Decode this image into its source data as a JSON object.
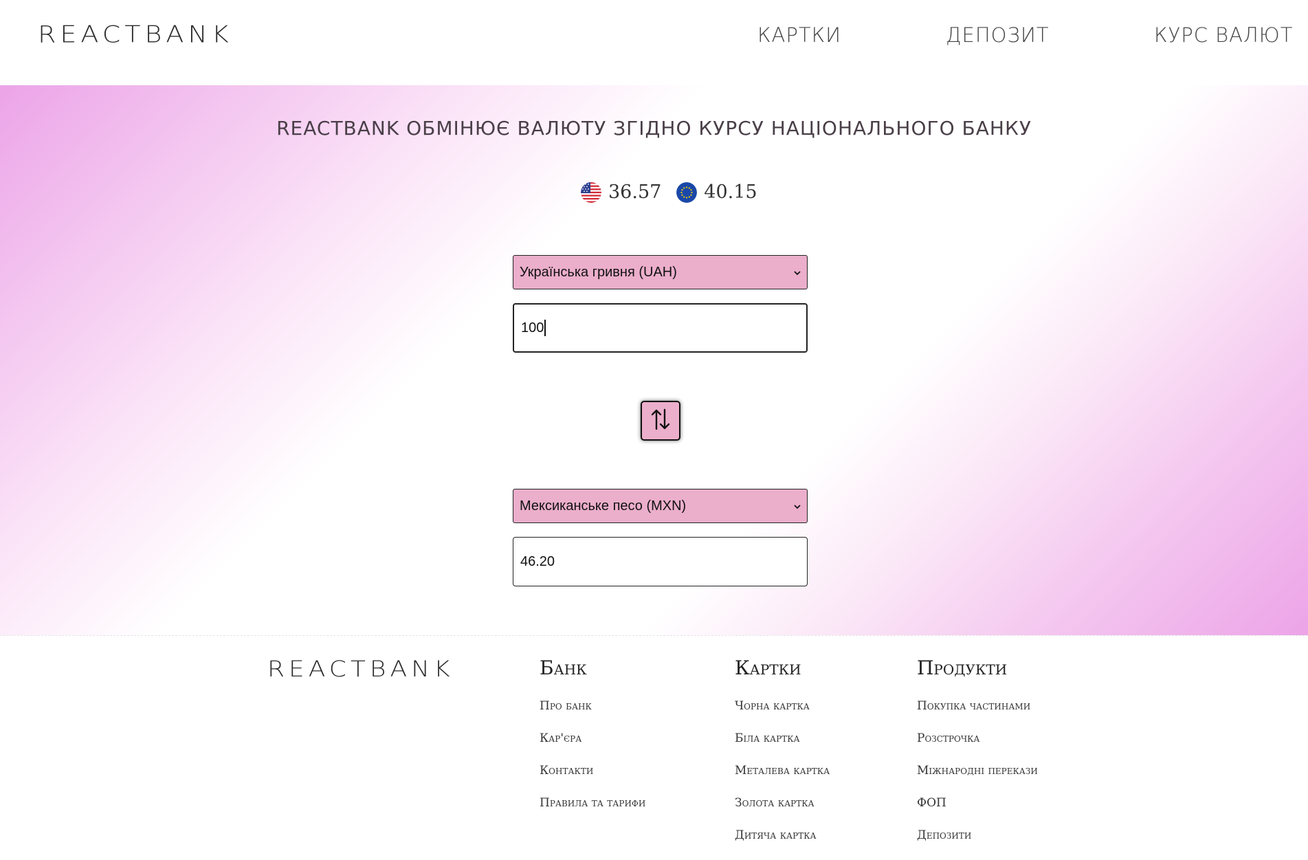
{
  "header": {
    "logo": "REACTBANK",
    "nav": [
      "КАРТКИ",
      "ДЕПОЗИТ",
      "КУРС ВАЛЮТ"
    ]
  },
  "hero": {
    "title": "REACTBANK ОБМІНЮЄ ВАЛЮТУ ЗГІДНО КУРСУ НАЦІОНАЛЬНОГО БАНКУ",
    "rates": [
      {
        "icon": "us-flag-icon",
        "value": "36.57"
      },
      {
        "icon": "eu-flag-icon",
        "value": "40.15"
      }
    ],
    "colors": {
      "accent_pink": "#ebaecb",
      "gradient_edge": "#eca4e8"
    }
  },
  "converter": {
    "from_currency": "Українська гривня (UAH)",
    "from_amount": "100",
    "to_currency": "Мексиканське песо (MXN)",
    "to_amount": "46.20",
    "swap_icon": "swap-vertical-arrows-icon"
  },
  "footer": {
    "logo": "REACTBANK",
    "columns": [
      {
        "title": "Банк",
        "links": [
          "Про банк",
          "Кар'єра",
          "Контакти",
          "Правила та тарифи"
        ]
      },
      {
        "title": "Картки",
        "links": [
          "Чорна картка",
          "Біла картка",
          "Металева картка",
          "Золота картка",
          "Дитяча картка"
        ]
      },
      {
        "title": "Продукти",
        "links": [
          "Покупка частинами",
          "Розстрочка",
          "Міжнародні перекази",
          "ФОП",
          "Депозити"
        ]
      }
    ]
  }
}
